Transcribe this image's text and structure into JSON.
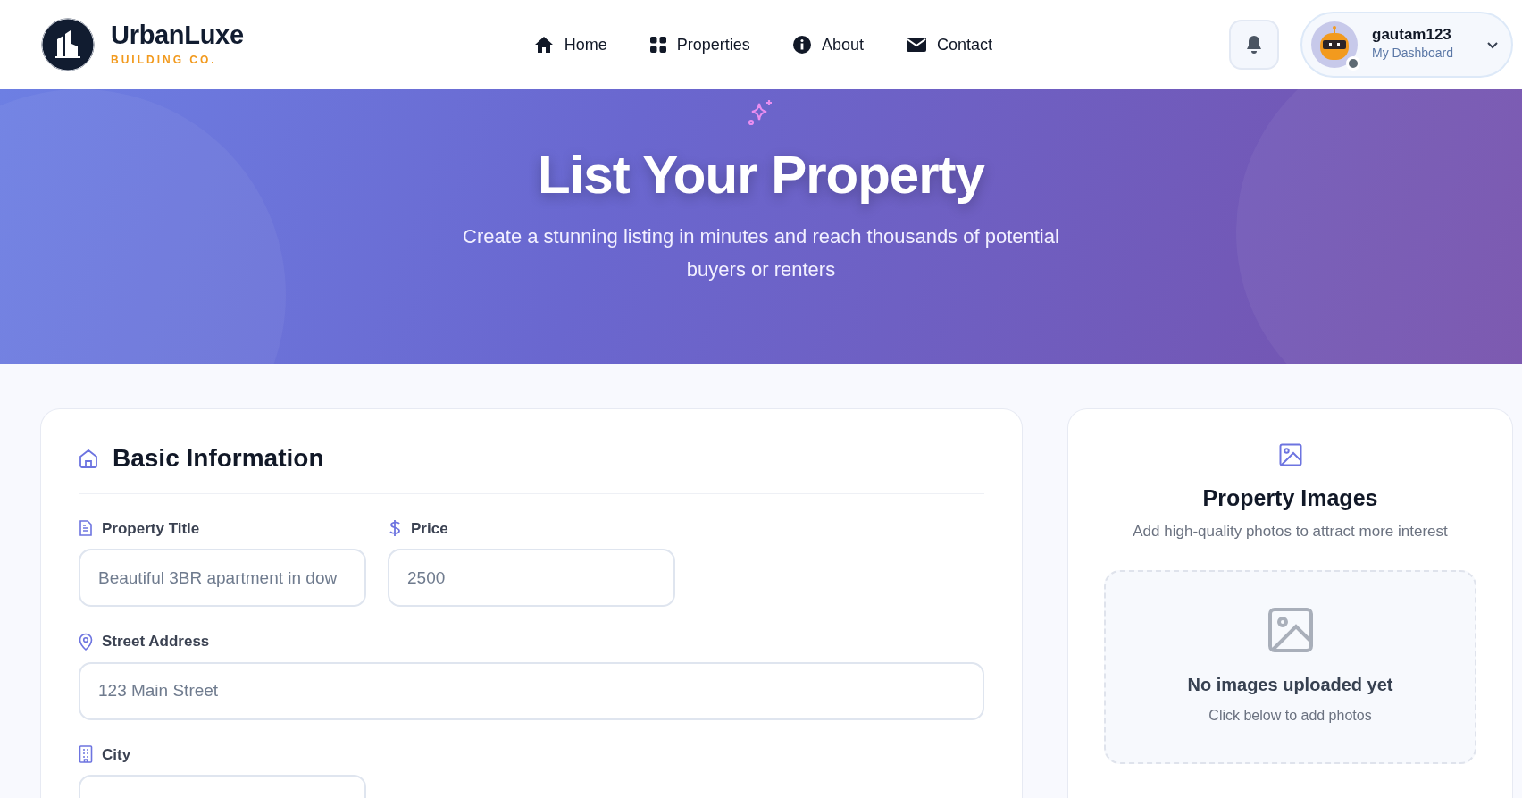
{
  "brand": {
    "name": "UrbanLuxe",
    "tagline": "BUILDING CO."
  },
  "nav": [
    {
      "label": "Home"
    },
    {
      "label": "Properties"
    },
    {
      "label": "About"
    },
    {
      "label": "Contact"
    }
  ],
  "user": {
    "name": "gautam123",
    "subtitle": "My Dashboard"
  },
  "hero": {
    "title": "List Your Property",
    "subtitle": "Create a stunning listing in minutes and reach thousands of potential buyers or renters"
  },
  "basic_info": {
    "title": "Basic Information",
    "rows": [
      [
        {
          "label": "Property Title",
          "placeholder": "Beautiful 3BR apartment in dow"
        },
        {
          "label": "Price",
          "placeholder": "2500"
        }
      ],
      [
        {
          "label": "Street Address",
          "placeholder": "123 Main Street"
        }
      ],
      [
        {
          "label": "City"
        }
      ]
    ]
  },
  "images": {
    "title": "Property Images",
    "subtitle": "Add high-quality photos to attract more interest",
    "empty_title": "No images uploaded yet",
    "empty_hint": "Click below to add photos"
  }
}
